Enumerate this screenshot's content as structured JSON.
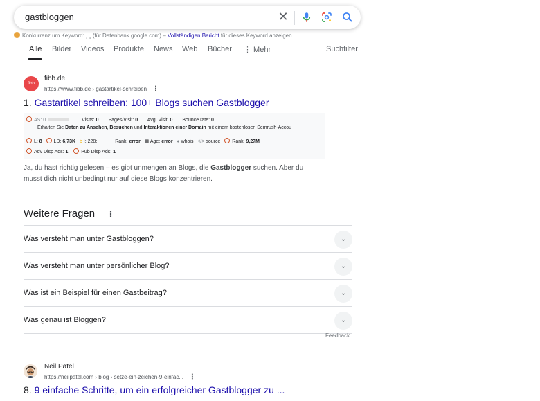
{
  "search": {
    "query": "gastbloggen"
  },
  "keyword_line": {
    "prefix": "Konkurrenz um Keyword: ",
    "dots": "¸.¸",
    "middle": " (für Datenbank google.com) – ",
    "link": "Vollständigen Bericht",
    "suffix": " für dieses Keyword anzeigen"
  },
  "tabs": [
    "Alle",
    "Bilder",
    "Videos",
    "Produkte",
    "News",
    "Web",
    "Bücher",
    "⋮ Mehr"
  ],
  "tools_label": "Suchfilter",
  "result1": {
    "favicon_text": "fibb",
    "site": "fibb.de",
    "url": "https://www.fibb.de › gastartikel-schreiben",
    "title_num": "1.",
    "title": "Gastartikel schreiben: 100+ Blogs suchen Gastblogger",
    "seo": {
      "as": "AS: 0",
      "visits_label": "Visits:",
      "visits": "0",
      "pages_label": "Pages/Visit:",
      "pages": "0",
      "avg_label": "Avg. Visit:",
      "avg": "0",
      "bounce_label": "Bounce rate:",
      "bounce": "0",
      "info_pre": "Erhalten Sie ",
      "info_b1": "Daten zu Ansehen",
      "info_mid1": ", ",
      "info_b2": "Besuchen",
      "info_mid2": " und ",
      "info_b3": "Interaktionen einer Domain",
      "info_post": " mit einem kostenlosen Semrush-Accou",
      "l_label": "L:",
      "l": "8",
      "ld_label": "LD:",
      "ld": "6,73K",
      "i_label": "I:",
      "i": "228;",
      "rank1_label": "Rank:",
      "rank1": "error",
      "age_label": "Age:",
      "age": "error",
      "whois": "whois",
      "source": "source",
      "rank2_label": "Rank:",
      "rank2": "9,27M",
      "adv_label": "Adv Disp Ads:",
      "adv": "1",
      "pub_label": "Pub Disp Ads:",
      "pub": "1"
    },
    "snippet_pre": "Ja, du hast richtig gelesen – es gibt unmengen an Blogs, die ",
    "snippet_bold": "Gastblogger",
    "snippet_post": " suchen. Aber du musst dich nicht unbedingt nur auf diese Blogs konzentrieren."
  },
  "weitere_fragen": {
    "title": "Weitere Fragen",
    "questions": [
      "Was versteht man unter Gastbloggen?",
      "Was versteht man unter persönlicher Blog?",
      "Was ist ein Beispiel für einen Gastbeitrag?",
      "Was genau ist Bloggen?"
    ],
    "feedback": "Feedback"
  },
  "result2": {
    "site": "Neil Patel",
    "url": "https://neilpatel.com › blog › setze-ein-zeichen-9-einfac...",
    "title_num": "8.",
    "title": "9 einfache Schritte, um ein erfolgreicher Gastblogger zu ..."
  }
}
